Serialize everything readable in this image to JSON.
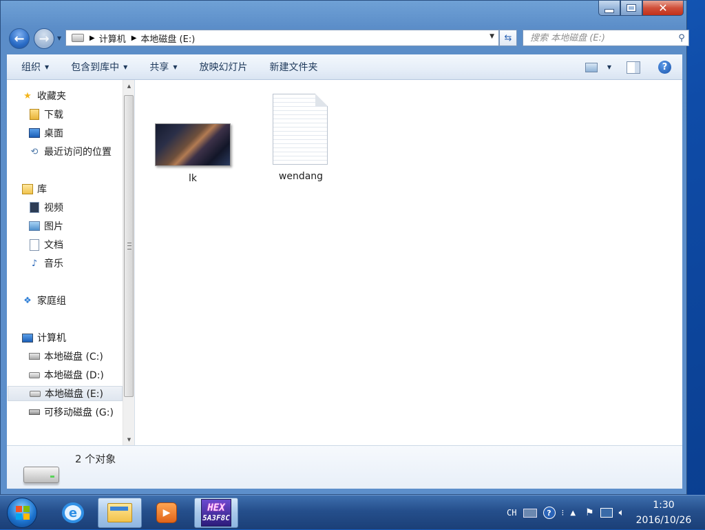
{
  "window": {
    "caption_buttons": {
      "minimize": "",
      "maximize": "",
      "close": "✕"
    }
  },
  "address_bar": {
    "breadcrumb": [
      "计算机",
      "本地磁盘 (E:)"
    ],
    "separator": "▶"
  },
  "search": {
    "placeholder": "搜索 本地磁盘 (E:)",
    "icon": "search-icon"
  },
  "toolbar": {
    "organize_label": "组织",
    "include_library_label": "包含到库中",
    "share_label": "共享",
    "slideshow_label": "放映幻灯片",
    "new_folder_label": "新建文件夹",
    "help_label": "?"
  },
  "sidebar": {
    "items": [
      {
        "label": "收藏夹",
        "icon": "star-icon"
      },
      {
        "label": "下载",
        "icon": "downloads-folder-icon"
      },
      {
        "label": "桌面",
        "icon": "desktop-icon"
      },
      {
        "label": "最近访问的位置",
        "icon": "recent-places-icon"
      },
      {
        "label": "库",
        "icon": "libraries-icon"
      },
      {
        "label": "视频",
        "icon": "videos-icon"
      },
      {
        "label": "图片",
        "icon": "pictures-icon"
      },
      {
        "label": "文档",
        "icon": "documents-icon"
      },
      {
        "label": "音乐",
        "icon": "music-icon"
      },
      {
        "label": "家庭组",
        "icon": "homegroup-icon"
      },
      {
        "label": "计算机",
        "icon": "computer-icon"
      },
      {
        "label": "本地磁盘 (C:)",
        "icon": "system-drive-icon"
      },
      {
        "label": "本地磁盘 (D:)",
        "icon": "drive-icon"
      },
      {
        "label": "本地磁盘 (E:)",
        "icon": "drive-icon",
        "selected": true
      },
      {
        "label": "可移动磁盘 (G:)",
        "icon": "removable-drive-icon"
      }
    ]
  },
  "files": [
    {
      "name": "lk",
      "type": "image",
      "icon": "image-thumbnail"
    },
    {
      "name": "wendang",
      "type": "text",
      "icon": "text-document-icon"
    }
  ],
  "details_pane": {
    "item_count": "2 个对象",
    "icon": "drive-icon"
  },
  "taskbar": {
    "apps": [
      {
        "name": "Internet Explorer",
        "icon": "ie-icon",
        "glyph": "e"
      },
      {
        "name": "Windows Explorer",
        "icon": "folder-icon",
        "active": true
      },
      {
        "name": "Media Player",
        "icon": "media-player-icon",
        "glyph": "▶"
      },
      {
        "name": "HEX",
        "icon": "hex-editor-icon",
        "line1": "HEX",
        "line2": "5A3F8C"
      }
    ],
    "tray": {
      "language": "CH",
      "clock_time": "1:30",
      "clock_date": "2016/10/26"
    }
  }
}
